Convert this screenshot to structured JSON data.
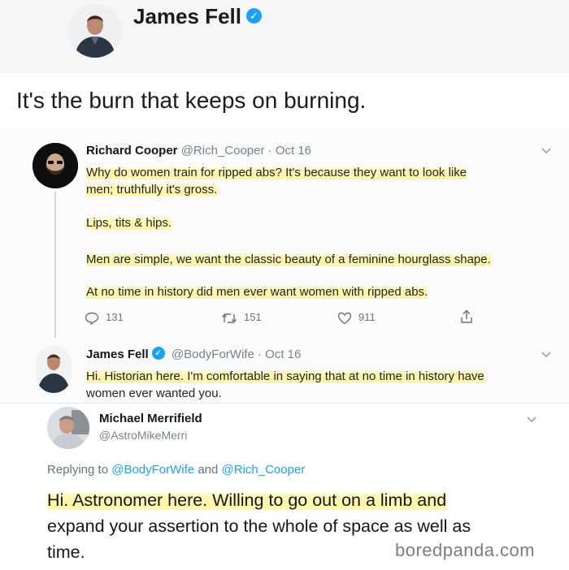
{
  "top_post": {
    "author": "James Fell",
    "caption": "It's the burn that keeps on burning."
  },
  "tweet1": {
    "name": "Richard Cooper",
    "handle": "@Rich_Cooper",
    "sep": "·",
    "date": "Oct 16",
    "line1": "Why do women train for ripped abs?  It's because they want to look like",
    "line2": "men; truthfully it's gross.",
    "line3": "Lips, tits & hips.",
    "line4": "Men are simple, we want the classic beauty of a feminine hourglass shape.",
    "line5": "At no time in history did men ever want women with ripped abs.",
    "replies": "131",
    "retweets": "151",
    "likes": "911"
  },
  "tweet2": {
    "name": "James Fell",
    "handle": "@BodyForWife",
    "sep": "·",
    "date": "Oct 16",
    "line1": "Hi. Historian here. I'm comfortable in saying that at no time in history have",
    "line2": "women ever wanted you."
  },
  "tweet3": {
    "name": "Michael Merrifield",
    "handle": "@AstroMikeMerri",
    "replying_prefix": "Replying to",
    "replying_to1": "@BodyForWife",
    "replying_and": "and",
    "replying_to2": "@Rich_Cooper",
    "line1": "Hi. Astronomer here. Willing to go out on a limb and",
    "line2": "expand your assertion to the whole of space as well as",
    "line3": "time."
  },
  "watermark": "boredpanda.com",
  "icons": {
    "verified": "verified-badge-icon",
    "chevron": "chevron-down-icon",
    "reply": "reply-icon",
    "retweet": "retweet-icon",
    "like": "heart-icon",
    "share": "share-icon"
  },
  "colors": {
    "verified": "#1da1f2",
    "link": "#1da1f2",
    "highlight": "#fff5a0"
  }
}
